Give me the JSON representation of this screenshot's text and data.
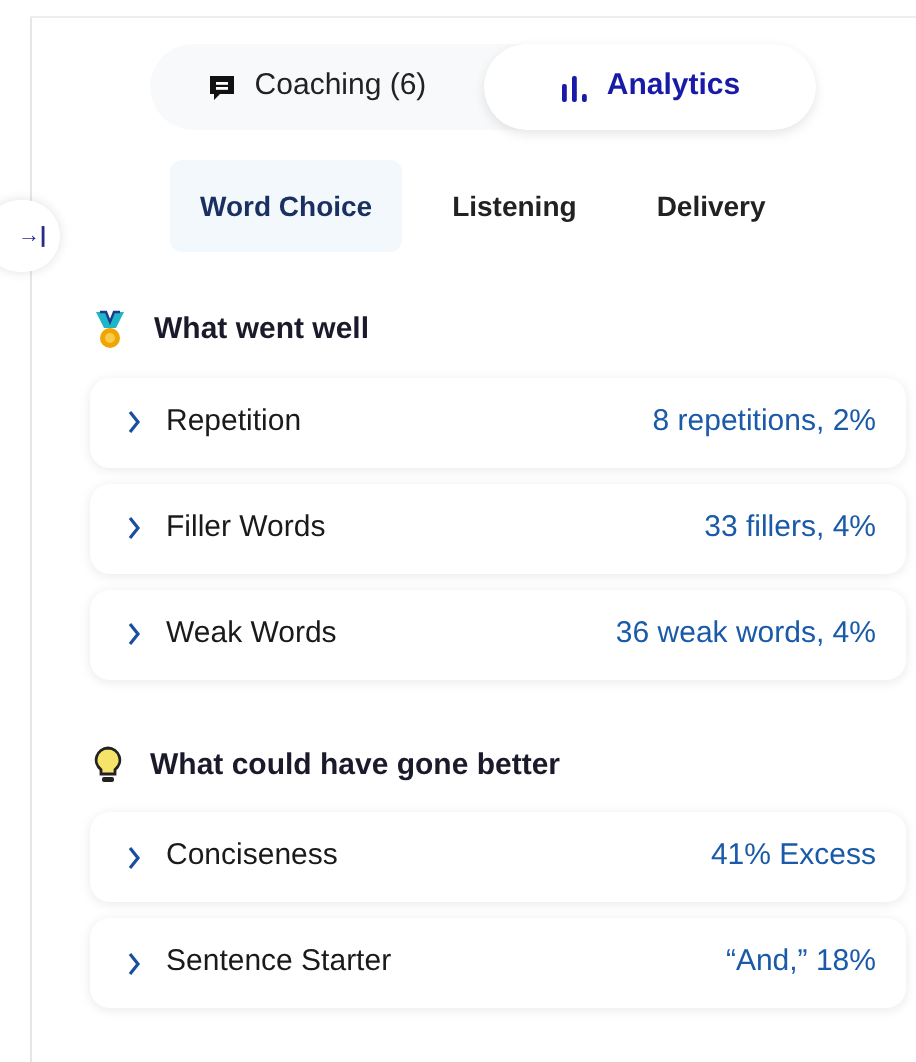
{
  "view_tabs": [
    {
      "label": "Coaching (6)",
      "kind": "chat",
      "selected": false
    },
    {
      "label": "Analytics",
      "kind": "chart",
      "selected": true
    }
  ],
  "sub_tabs": [
    {
      "label": "Word Choice",
      "selected": true
    },
    {
      "label": "Listening",
      "selected": false
    },
    {
      "label": "Delivery",
      "selected": false
    }
  ],
  "collapse_button": {
    "symbol": "→|"
  },
  "sections": [
    {
      "title": "What went well",
      "kind": "medal",
      "items": [
        {
          "label": "Repetition",
          "value": "8 repetitions, 2%"
        },
        {
          "label": "Filler Words",
          "value": "33 fillers, 4%"
        },
        {
          "label": "Weak Words",
          "value": "36 weak words, 4%"
        }
      ]
    },
    {
      "title": "What could have gone better",
      "kind": "bulb",
      "items": [
        {
          "label": "Conciseness",
          "value": "41% Excess"
        },
        {
          "label": "Sentence Starter",
          "value": "“And,” 18%"
        }
      ]
    }
  ]
}
